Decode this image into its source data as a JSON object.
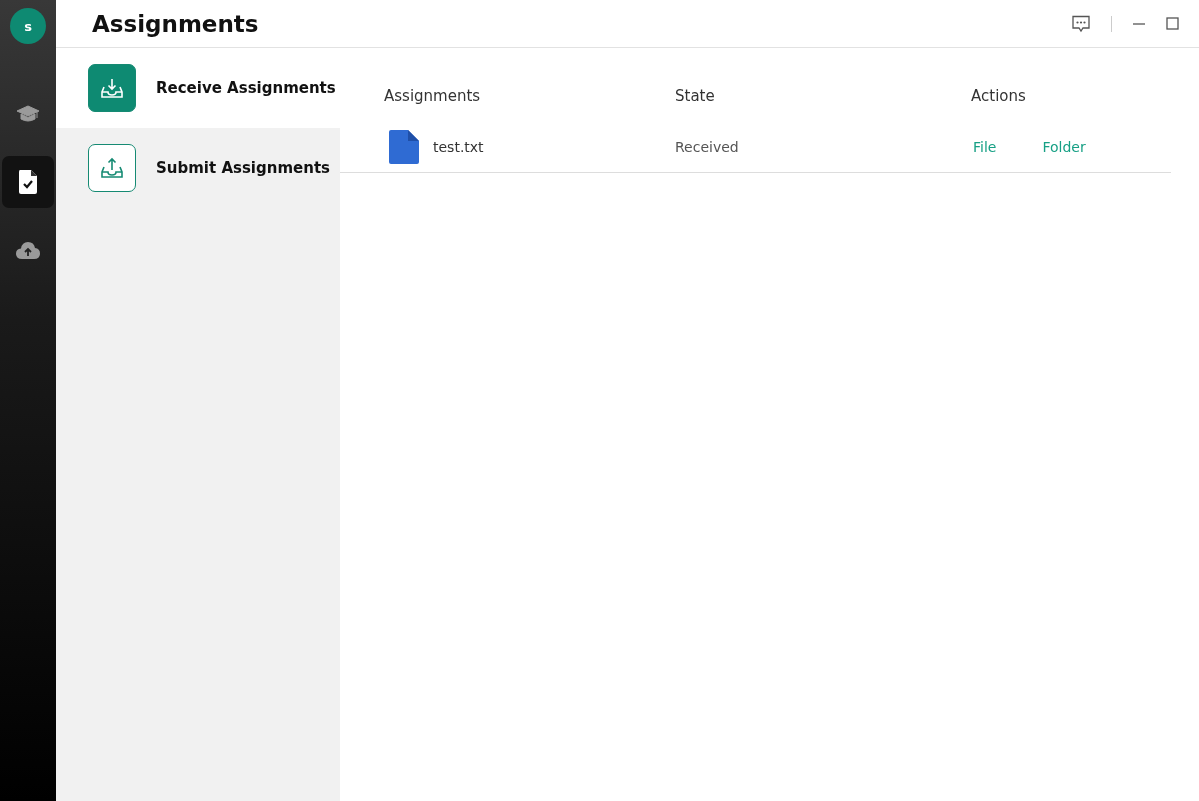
{
  "avatar": {
    "initial": "s"
  },
  "rail": [
    {
      "kind": "cap",
      "selected": false
    },
    {
      "kind": "file-check",
      "selected": true
    },
    {
      "kind": "cloud-upload",
      "selected": false
    }
  ],
  "header": {
    "title": "Assignments"
  },
  "subnav": [
    {
      "kind": "receive",
      "label": "Receive Assignments",
      "selected": true
    },
    {
      "kind": "submit",
      "label": "Submit Assignments",
      "selected": false
    }
  ],
  "table": {
    "columns": [
      "Assignments",
      "State",
      "Actions"
    ],
    "rows": [
      {
        "name": "test.txt",
        "state": "Received",
        "actions": [
          "File",
          "Folder"
        ]
      }
    ]
  }
}
